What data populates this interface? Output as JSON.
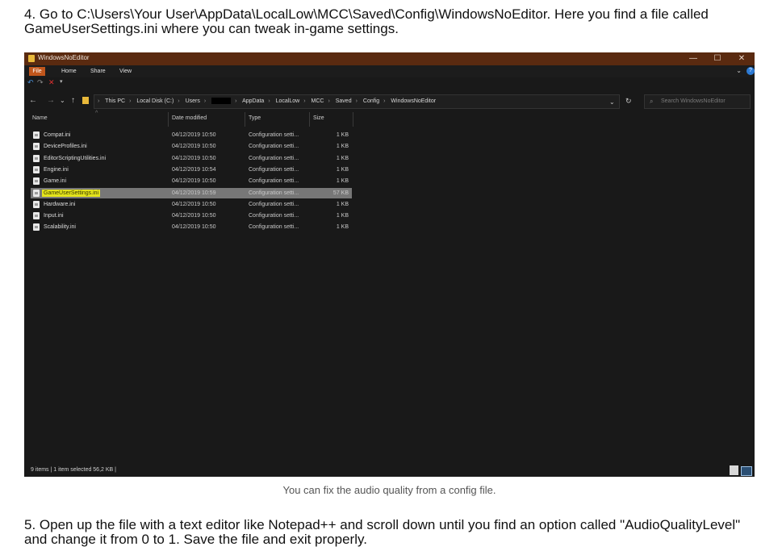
{
  "article": {
    "step4": "4. Go to C:\\Users\\Your User\\AppData\\LocalLow\\MCC\\Saved\\Config\\WindowsNoEditor. Here you find a file called GameUserSettings.ini where you can tweak in-game settings.",
    "caption": "You can fix the audio quality from a config file.",
    "step5": "5. Open up the file with a text editor like Notepad++ and scroll down until you find an option called \"AudioQualityLevel\" and change it from 0 to 1. Save the file and exit properly."
  },
  "window": {
    "title": "WindowsNoEditor",
    "controls": {
      "minimize": "—",
      "maximize": "☐",
      "close": "✕"
    },
    "ribbon_tabs": [
      "File",
      "Home",
      "Share",
      "View"
    ],
    "ribbon_expand": "⌄",
    "help": "?",
    "nav": {
      "back": "←",
      "forward": "→",
      "recent": "⌄",
      "up": "↑"
    },
    "breadcrumbs": [
      "This PC",
      "Local Disk (C:)",
      "Users",
      "",
      "AppData",
      "LocalLow",
      "MCC",
      "Saved",
      "Config",
      "WindowsNoEditor"
    ],
    "address_dropdown": "⌄",
    "refresh": "↻",
    "search_placeholder": "Search WindowsNoEditor",
    "columns": {
      "name": "Name",
      "date": "Date modified",
      "type": "Type",
      "size": "Size"
    },
    "files": [
      {
        "name": "Compat.ini",
        "date": "04/12/2019 10:50",
        "type": "Configuration setti...",
        "size": "1 KB"
      },
      {
        "name": "DeviceProfiles.ini",
        "date": "04/12/2019 10:50",
        "type": "Configuration setti...",
        "size": "1 KB"
      },
      {
        "name": "EditorScriptingUtilities.ini",
        "date": "04/12/2019 10:50",
        "type": "Configuration setti...",
        "size": "1 KB"
      },
      {
        "name": "Engine.ini",
        "date": "04/12/2019 10:54",
        "type": "Configuration setti...",
        "size": "1 KB"
      },
      {
        "name": "Game.ini",
        "date": "04/12/2019 10:50",
        "type": "Configuration setti...",
        "size": "1 KB"
      },
      {
        "name": "GameUserSettings.ini",
        "date": "04/12/2019 10:59",
        "type": "Configuration setti...",
        "size": "57 KB",
        "selected": true
      },
      {
        "name": "Hardware.ini",
        "date": "04/12/2019 10:50",
        "type": "Configuration setti...",
        "size": "1 KB"
      },
      {
        "name": "Input.ini",
        "date": "04/12/2019 10:50",
        "type": "Configuration setti...",
        "size": "1 KB"
      },
      {
        "name": "Scalability.ini",
        "date": "04/12/2019 10:50",
        "type": "Configuration setti...",
        "size": "1 KB"
      }
    ],
    "status": "9 items  |  1 item selected  56,2 KB  |",
    "colors": {
      "titlebar": "#5a2a10",
      "file_tab": "#c0561c",
      "background": "#191919",
      "highlight": "#e4e41c",
      "selection": "#777777"
    }
  }
}
